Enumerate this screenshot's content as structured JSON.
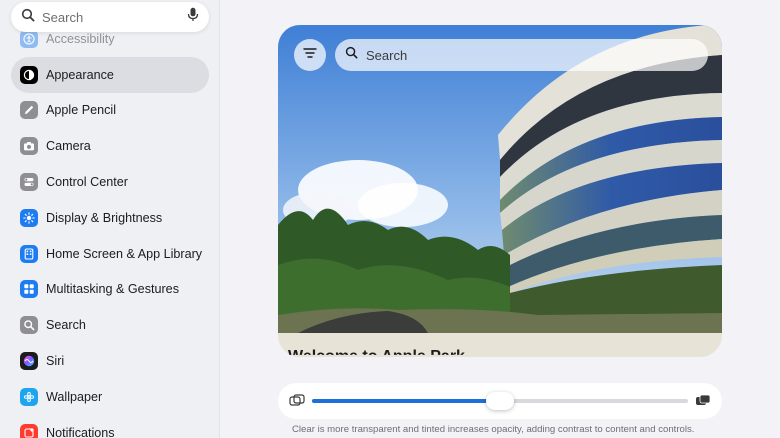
{
  "sidebar": {
    "search_placeholder": "Search",
    "items": [
      {
        "label": "Accessibility",
        "icon": "accessibility-icon",
        "color": "#1e7cf2"
      },
      {
        "label": "Appearance",
        "icon": "appearance-icon",
        "color": "#000000"
      },
      {
        "label": "Apple Pencil",
        "icon": "pencil-icon",
        "color": "#8e8e93"
      },
      {
        "label": "Camera",
        "icon": "camera-icon",
        "color": "#8e8e93"
      },
      {
        "label": "Control Center",
        "icon": "control-center-icon",
        "color": "#8e8e93"
      },
      {
        "label": "Display & Brightness",
        "icon": "brightness-icon",
        "color": "#1e7cf2"
      },
      {
        "label": "Home Screen & App Library",
        "icon": "home-screen-icon",
        "color": "#1e7cf2"
      },
      {
        "label": "Multitasking & Gestures",
        "icon": "multitasking-icon",
        "color": "#1e7cf2"
      },
      {
        "label": "Search",
        "icon": "search-icon",
        "color": "#8e8e93"
      },
      {
        "label": "Siri",
        "icon": "siri-icon",
        "color": "#1c1c1e"
      },
      {
        "label": "Wallpaper",
        "icon": "wallpaper-icon",
        "color": "#1ea5f0"
      },
      {
        "label": "Notifications",
        "icon": "notifications-icon",
        "color": "#ff3b30"
      }
    ],
    "selected_index": 1
  },
  "preview": {
    "search_placeholder": "Search",
    "title_peek": "Welcome to Apple Park"
  },
  "slider": {
    "value_fraction": 0.5,
    "accent": "#1e6fd9",
    "left_icon": "clear-icon",
    "right_icon": "tinted-icon"
  },
  "caption": "Clear is more transparent and tinted increases opacity, adding contrast to content and controls."
}
